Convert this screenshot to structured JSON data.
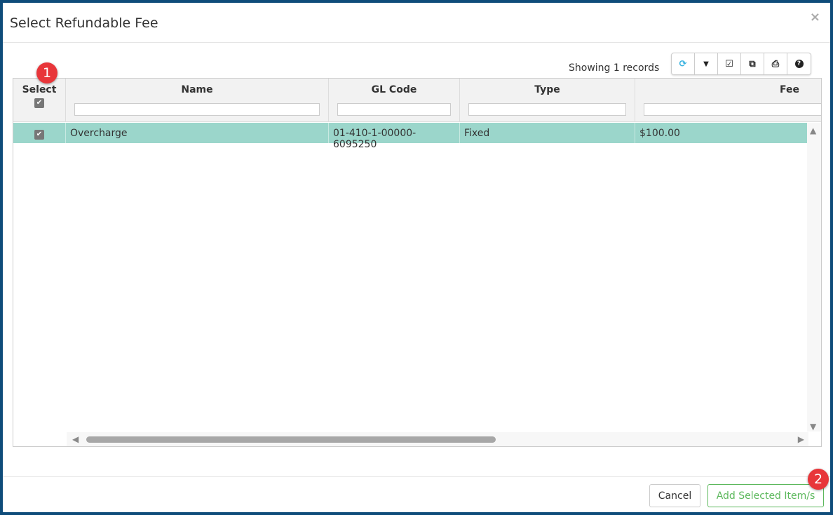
{
  "dialog": {
    "title": "Select Refundable Fee",
    "close_icon": "×"
  },
  "status": "Showing 1 records",
  "toolbar": [
    {
      "name": "refresh-icon",
      "glyph": "⟳",
      "color": "#3bb3e0"
    },
    {
      "name": "filter-icon",
      "glyph": "▼",
      "color": "#222"
    },
    {
      "name": "check-all-icon",
      "glyph": "☑",
      "color": "#222"
    },
    {
      "name": "copy-icon",
      "glyph": "⧉",
      "color": "#222"
    },
    {
      "name": "print-icon",
      "glyph": "⎙",
      "color": "#222"
    },
    {
      "name": "help-icon",
      "glyph": "?",
      "color": "#222"
    }
  ],
  "columns": [
    "Select",
    "Name",
    "GL Code",
    "Type",
    "Fee"
  ],
  "rows": [
    {
      "checked": true,
      "name": "Overcharge",
      "gl_code": "01-410-1-00000-6095250",
      "type": "Fixed",
      "fee": "$100.00"
    }
  ],
  "footer": {
    "cancel": "Cancel",
    "add": "Add Selected Item/s"
  },
  "badges": [
    "1",
    "2"
  ],
  "colors": {
    "row_selected": "#9bd6cb",
    "add_button": "#5cb85c",
    "badge": "#e8363a"
  }
}
